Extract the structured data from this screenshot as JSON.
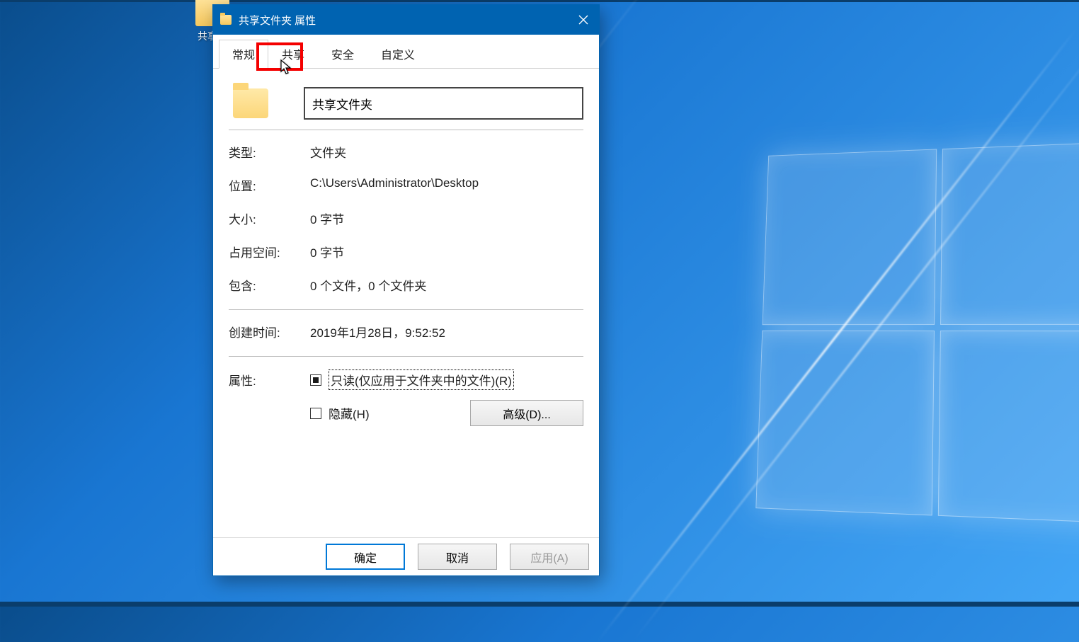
{
  "desktop": {
    "folder_label": "共享文"
  },
  "dialog": {
    "title": "共享文件夹 属性",
    "tabs": {
      "general": "常规",
      "share": "共享",
      "security": "安全",
      "custom": "自定义"
    },
    "folder_name": "共享文件夹",
    "rows": {
      "type_label": "类型:",
      "type_value": "文件夹",
      "location_label": "位置:",
      "location_value": "C:\\Users\\Administrator\\Desktop",
      "size_label": "大小:",
      "size_value": "0 字节",
      "disk_label": "占用空间:",
      "disk_value": "0 字节",
      "contains_label": "包含:",
      "contains_value": "0 个文件，0 个文件夹",
      "created_label": "创建时间:",
      "created_value": "2019年1月28日，9:52:52"
    },
    "attrs": {
      "label": "属性:",
      "readonly_label": "只读(仅应用于文件夹中的文件)(R)",
      "hidden_label": "隐藏(H)",
      "advanced_label": "高级(D)..."
    },
    "footer": {
      "ok": "确定",
      "cancel": "取消",
      "apply": "应用(A)"
    }
  }
}
